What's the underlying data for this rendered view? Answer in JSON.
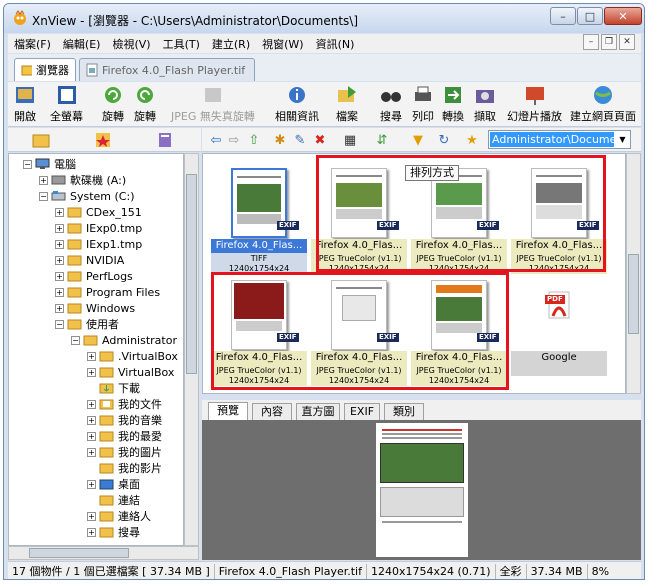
{
  "window": {
    "title": "XnView - [瀏覽器 - C:\\Users\\Administrator\\Documents\\]",
    "minimize": "–",
    "maximize": "□",
    "close": "✕"
  },
  "menubar": {
    "items": [
      "檔案(F)",
      "編輯(E)",
      "檢視(V)",
      "工具(T)",
      "建立(R)",
      "視窗(W)",
      "資訊(N)"
    ],
    "mdi": [
      "–",
      "❐",
      "✕"
    ]
  },
  "tabs": {
    "browser": "瀏覽器",
    "file": "Firefox 4.0_Flash Player.tif"
  },
  "toolbar": {
    "open": "開啟",
    "fullscreen": "全螢幕",
    "rotate_left": "旋轉",
    "rotate_right": "旋轉",
    "jpeg_lossless": "JPEG 無失真旋轉",
    "properties": "相關資訊",
    "file": "檔案",
    "search": "搜尋",
    "print": "列印",
    "convert": "轉換",
    "capture": "擷取",
    "slideshow": "幻燈片播放",
    "create_web": "建立網頁頁面"
  },
  "address": {
    "value": "Administrator\\Documents\\"
  },
  "tree": [
    {
      "label": "電腦"
    },
    {
      "label": "軟碟機 (A:)"
    },
    {
      "label": "System (C:)"
    },
    {
      "label": "CDex_151"
    },
    {
      "label": "IExp0.tmp"
    },
    {
      "label": "IExp1.tmp"
    },
    {
      "label": "NVIDIA"
    },
    {
      "label": "PerfLogs"
    },
    {
      "label": "Program Files"
    },
    {
      "label": "Windows"
    },
    {
      "label": "使用者"
    },
    {
      "label": "Administrator"
    },
    {
      "label": ".VirtualBox"
    },
    {
      "label": "VirtualBox"
    },
    {
      "label": "下載"
    },
    {
      "label": "我的文件"
    },
    {
      "label": "我的音樂"
    },
    {
      "label": "我的最愛"
    },
    {
      "label": "我的圖片"
    },
    {
      "label": "我的影片"
    },
    {
      "label": "桌面"
    },
    {
      "label": "連結"
    },
    {
      "label": "連絡人"
    },
    {
      "label": "搜尋"
    }
  ],
  "tooltip": "排列方式",
  "thumbnails": [
    {
      "name": "Firefox 4.0_Flas...",
      "format": "TIFF",
      "res": "1240x1754x24",
      "badge": "EXIF"
    },
    {
      "name": "Firefox 4.0_Flas...",
      "format": "JPEG TrueColor (v1.1)",
      "res": "1240x1754x24",
      "badge": "EXIF"
    },
    {
      "name": "Firefox 4.0_Flas...",
      "format": "JPEG TrueColor (v1.1)",
      "res": "1240x1754x24",
      "badge": "EXIF"
    },
    {
      "name": "Firefox 4.0_Flas...",
      "format": "JPEG TrueColor (v1.1)",
      "res": "1240x1754x24",
      "badge": "EXIF"
    },
    {
      "name": "Firefox 4.0_Flas...",
      "format": "JPEG TrueColor (v1.1)",
      "res": "1240x1754x24",
      "badge": "EXIF"
    },
    {
      "name": "Firefox 4.0_Flas...",
      "format": "JPEG TrueColor (v1.1)",
      "res": "1240x1754x24",
      "badge": "EXIF"
    },
    {
      "name": "Firefox 4.0_Flas...",
      "format": "JPEG TrueColor (v1.1)",
      "res": "1240x1754x24",
      "badge": "EXIF"
    },
    {
      "name": "Google",
      "format": "",
      "res": "",
      "badge": "PDF"
    }
  ],
  "preview_tabs": [
    "預覽",
    "內容",
    "直方圖",
    "EXIF",
    "類別"
  ],
  "status": {
    "count": "17 個物件 / 1 個已選檔案 [ 37.34 MB ]",
    "file": "Firefox 4.0_Flash Player.tif",
    "dims": "1240x1754x24 (0.71)",
    "color": "全彩",
    "size": "37.34 MB",
    "zoom": "8%"
  },
  "colors": {
    "selection": "#3c78d8",
    "highlight_box": "#e4141e",
    "title_bg": "#d6e0ee"
  }
}
